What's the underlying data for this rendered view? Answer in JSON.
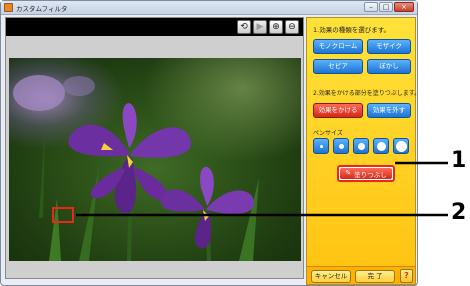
{
  "window": {
    "title": "カスタムフィルタ",
    "controls": [
      "–",
      "□",
      "×"
    ]
  },
  "toolbar": {
    "buttons": [
      {
        "name": "rotate-icon",
        "glyph": "⟲",
        "enabled": true
      },
      {
        "name": "play-icon",
        "glyph": "▶",
        "enabled": false
      },
      {
        "name": "zoom-in-icon",
        "glyph": "⊕",
        "enabled": true
      },
      {
        "name": "zoom-out-icon",
        "glyph": "⊖",
        "enabled": true
      }
    ]
  },
  "panel": {
    "step1_label": "1.効果の種類を選びます。",
    "effects": {
      "monochrome": "モノクローム",
      "mosaic": "モザイク",
      "sepia": "セピア",
      "blur": "ぼかし"
    },
    "step2_label": "2.効果をかける部分を塗りつぶします。",
    "apply_effect": "効果をかける",
    "remove_effect": "効果を外す",
    "pen_size_label": "ペンサイズ",
    "fill_button": "塗りつぶし"
  },
  "footer": {
    "cancel": "キャンセル",
    "done": "完 了",
    "help": "?"
  },
  "callouts": {
    "one": "1",
    "two": "2"
  },
  "colors": {
    "panel_yellow": "#ffd21c",
    "button_blue": "#2a83e0",
    "button_red": "#e0321f",
    "highlight_red": "#e8281e"
  }
}
